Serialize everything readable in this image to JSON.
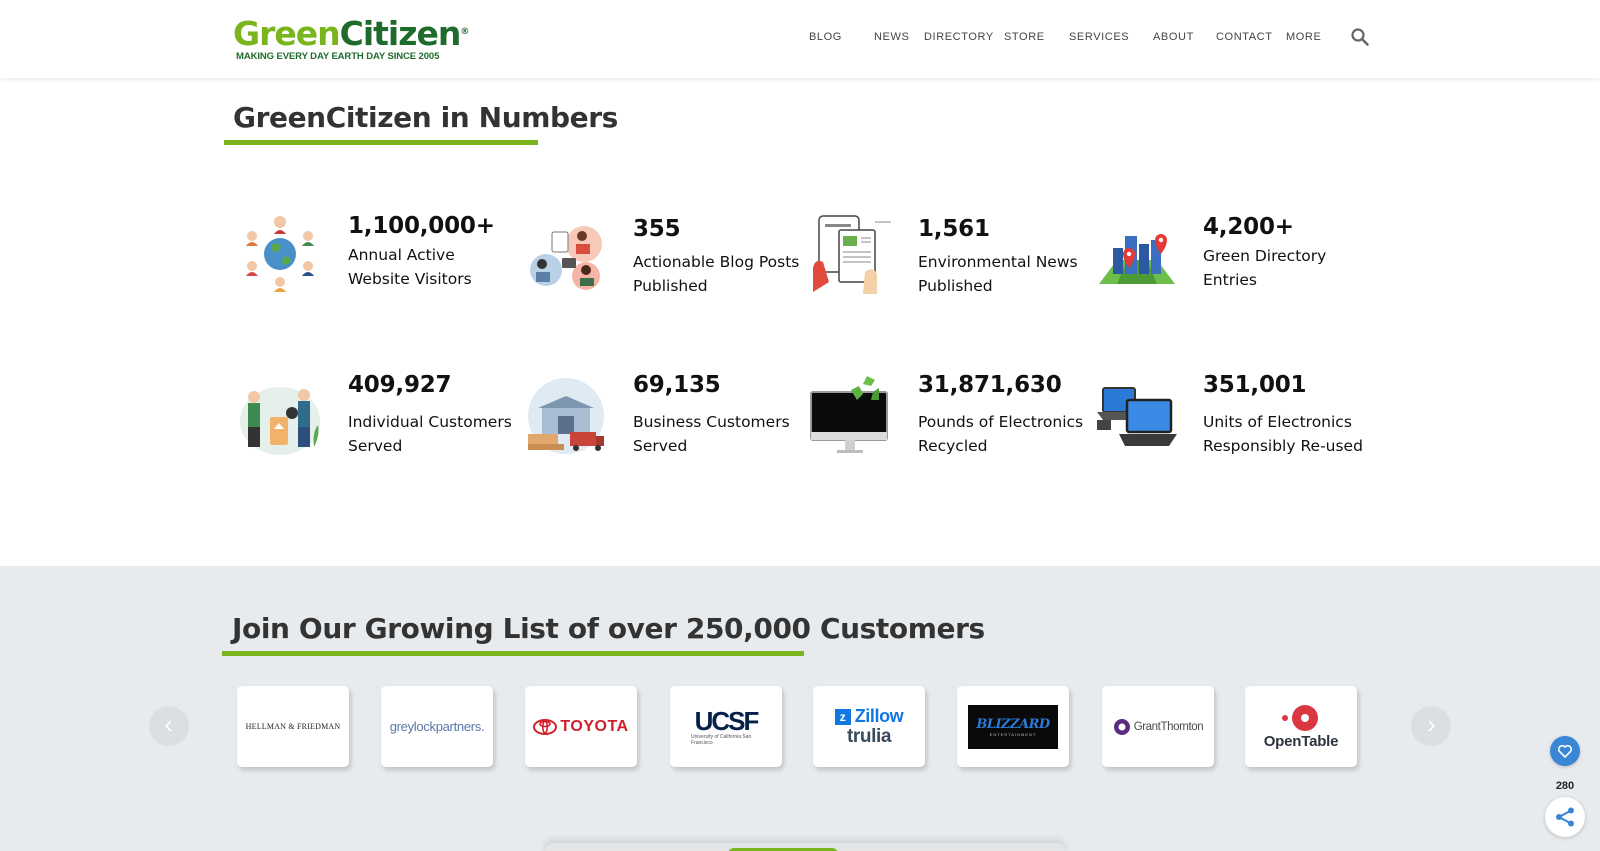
{
  "header": {
    "logo": {
      "green": "Green",
      "dark": "Citizen",
      "reg": "®",
      "tagline": "MAKING EVERY DAY EARTH DAY SINCE 2005"
    },
    "nav": [
      "BLOG",
      "NEWS",
      "DIRECTORY",
      "STORE",
      "SERVICES",
      "ABOUT",
      "CONTACT",
      "MORE"
    ],
    "search_icon": "search-icon"
  },
  "numbers_section": {
    "title": "GreenCitizen in Numbers",
    "stats": [
      {
        "value": "1,100,000+",
        "label": "Annual Active Website Visitors",
        "icon": "people-globe-icon"
      },
      {
        "value": "355",
        "label": "Actionable Blog Posts Published",
        "icon": "blog-readers-icon"
      },
      {
        "value": "1,561",
        "label": "Environmental News Published",
        "icon": "news-phone-icon"
      },
      {
        "value": "4,200+",
        "label": "Green Directory Entries",
        "icon": "city-map-icon"
      },
      {
        "value": "409,927",
        "label": "Individual Customers Served",
        "icon": "recycling-people-icon"
      },
      {
        "value": "69,135",
        "label": "Business Customers Served",
        "icon": "warehouse-truck-icon"
      },
      {
        "value": "31,871,630",
        "label": "Pounds of Electronics Recycled",
        "icon": "monitor-recycle-icon"
      },
      {
        "value": "351,001",
        "label": "Units of Electronics Responsibly Re-used",
        "icon": "laptops-icon"
      }
    ]
  },
  "customers_section": {
    "title": "Join Our Growing List of over 250,000 Customers",
    "logos": [
      {
        "name": "HELLMAN & FRIEDMAN"
      },
      {
        "name": "greylockpartners."
      },
      {
        "name": "TOYOTA"
      },
      {
        "name": "UCSF",
        "sub": "University of California San Francisco"
      },
      {
        "name": "Zillow",
        "name2": "trulia"
      },
      {
        "name": "BLIZZARD",
        "sub": "ENTERTAINMENT"
      },
      {
        "name": "GrantThornton"
      },
      {
        "name": "OpenTable"
      }
    ],
    "prev_icon": "chevron-left-icon",
    "next_icon": "chevron-right-icon"
  },
  "share": {
    "count": "280"
  },
  "colors": {
    "accent_green": "#7ab51d",
    "dark_green": "#1e6b2c",
    "band_gray": "#e8ebed",
    "share_blue": "#3a86d6"
  }
}
